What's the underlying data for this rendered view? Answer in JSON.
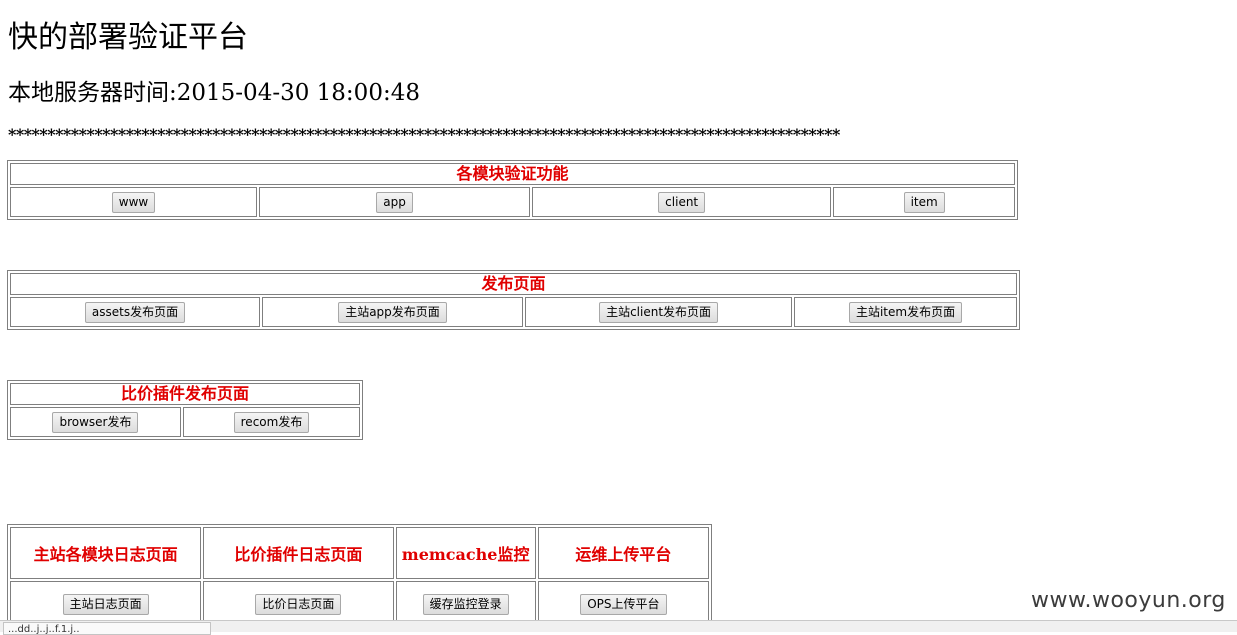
{
  "page": {
    "title": "快的部署验证平台",
    "server_time_label": "本地服务器时间:",
    "server_time_value": "2015-04-30 18:00:48",
    "divider": "**********************************************************************************************************"
  },
  "module_verify": {
    "title": "各模块验证功能",
    "buttons": [
      "www",
      "app",
      "client",
      "item"
    ]
  },
  "publish_pages": {
    "title": "发布页面",
    "buttons": [
      "assets发布页面",
      "主站app发布页面",
      "主站client发布页面",
      "主站item发布页面"
    ]
  },
  "plugin_publish": {
    "title": "比价插件发布页面",
    "buttons": [
      "browser发布",
      "recom发布"
    ]
  },
  "logs_panel": {
    "headers": [
      "主站各模块日志页面",
      "比价插件日志页面",
      "memcache监控",
      "运维上传平台"
    ],
    "buttons": [
      "主站日志页面",
      "比价日志页面",
      "缓存监控登录",
      "OPS上传平台"
    ]
  },
  "statusbar": {
    "text": "...dd..j..j..f.1.j.."
  },
  "watermark": "www.wooyun.org"
}
